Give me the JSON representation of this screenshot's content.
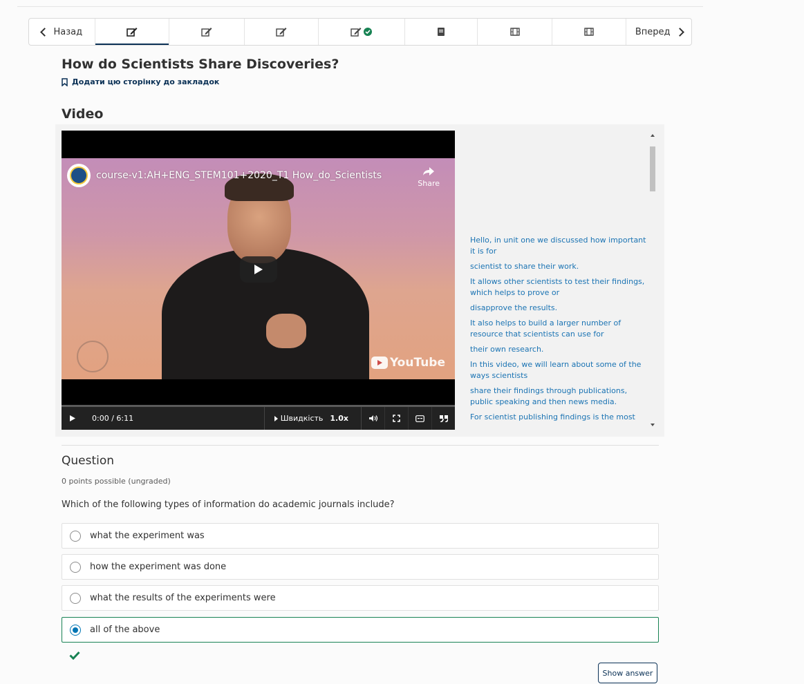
{
  "nav": {
    "prev_label": "Назад",
    "next_label": "Вперед",
    "tabs": [
      {
        "icon": "edit-icon",
        "active": true,
        "complete": false
      },
      {
        "icon": "edit-icon",
        "active": false,
        "complete": false
      },
      {
        "icon": "edit-icon",
        "active": false,
        "complete": false
      },
      {
        "icon": "edit-icon",
        "active": false,
        "complete": true
      },
      {
        "icon": "book-icon",
        "active": false,
        "complete": false
      },
      {
        "icon": "film-icon",
        "active": false,
        "complete": false
      },
      {
        "icon": "film-icon",
        "active": false,
        "complete": false
      }
    ]
  },
  "unit": {
    "title": "How do Scientists Share Discoveries?",
    "bookmark_label": "Додати цю сторінку до закладок"
  },
  "video": {
    "heading": "Video",
    "title": "course-v1:AH+ENG_STEM101+2020_T1 How_do_Scientists",
    "share_label": "Share",
    "time": "0:00 / 6:11",
    "speed_label": "Швидкість",
    "speed_value": "1.0x",
    "progress": 0.0,
    "youtube_label": "YouTube",
    "transcript": [
      "Hello, in unit one we discussed how important it is for",
      "scientist to share their work.",
      "It allows other scientists to test their findings, which helps to prove or",
      "disapprove the results.",
      "It also helps to build a larger number of resource that scientists can use for",
      "their own research.",
      "In this video, we will learn about some of the ways scientists",
      "share their findings through publications, public speaking and then news media.",
      "For scientist publishing findings is the most"
    ]
  },
  "question": {
    "heading": "Question",
    "points": "0 points possible (ungraded)",
    "prompt": "Which of the following types of information do academic journals include?",
    "choices": [
      {
        "label": "what the experiment was",
        "selected": false
      },
      {
        "label": "how the experiment was done",
        "selected": false
      },
      {
        "label": "what the results of the experiments were",
        "selected": false
      },
      {
        "label": "all of the above",
        "selected": true,
        "correct": true
      }
    ],
    "show_answer_label": "Show answer"
  },
  "colors": {
    "accent": "#0a3055",
    "link": "#1a73b3",
    "correct": "#178253",
    "radio": "#0075b4"
  }
}
